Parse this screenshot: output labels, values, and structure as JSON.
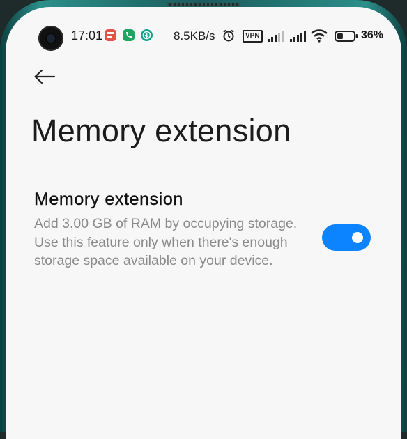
{
  "status_bar": {
    "time": "17:01",
    "network_speed": "8.5KB/s",
    "vpn_label": "VPN",
    "battery_percent": "36%",
    "battery_level": 0.36,
    "icons": [
      "camera",
      "app-notification-red",
      "phone-call-icon",
      "download-icon",
      "alarm-icon",
      "vpn-icon",
      "signal-icon",
      "signal-icon",
      "wifi-icon",
      "battery-icon"
    ]
  },
  "header": {
    "back_icon": "arrow-left-icon",
    "title": "Memory extension"
  },
  "setting": {
    "title": "Memory extension",
    "description": "Add 3.00 GB of RAM by occupying storage. Use this feature only when there's enough storage space available on your device.",
    "enabled": true
  },
  "colors": {
    "accent": "#0d84ff",
    "background": "#f7f7f7",
    "frame": "#2b8f8a"
  }
}
